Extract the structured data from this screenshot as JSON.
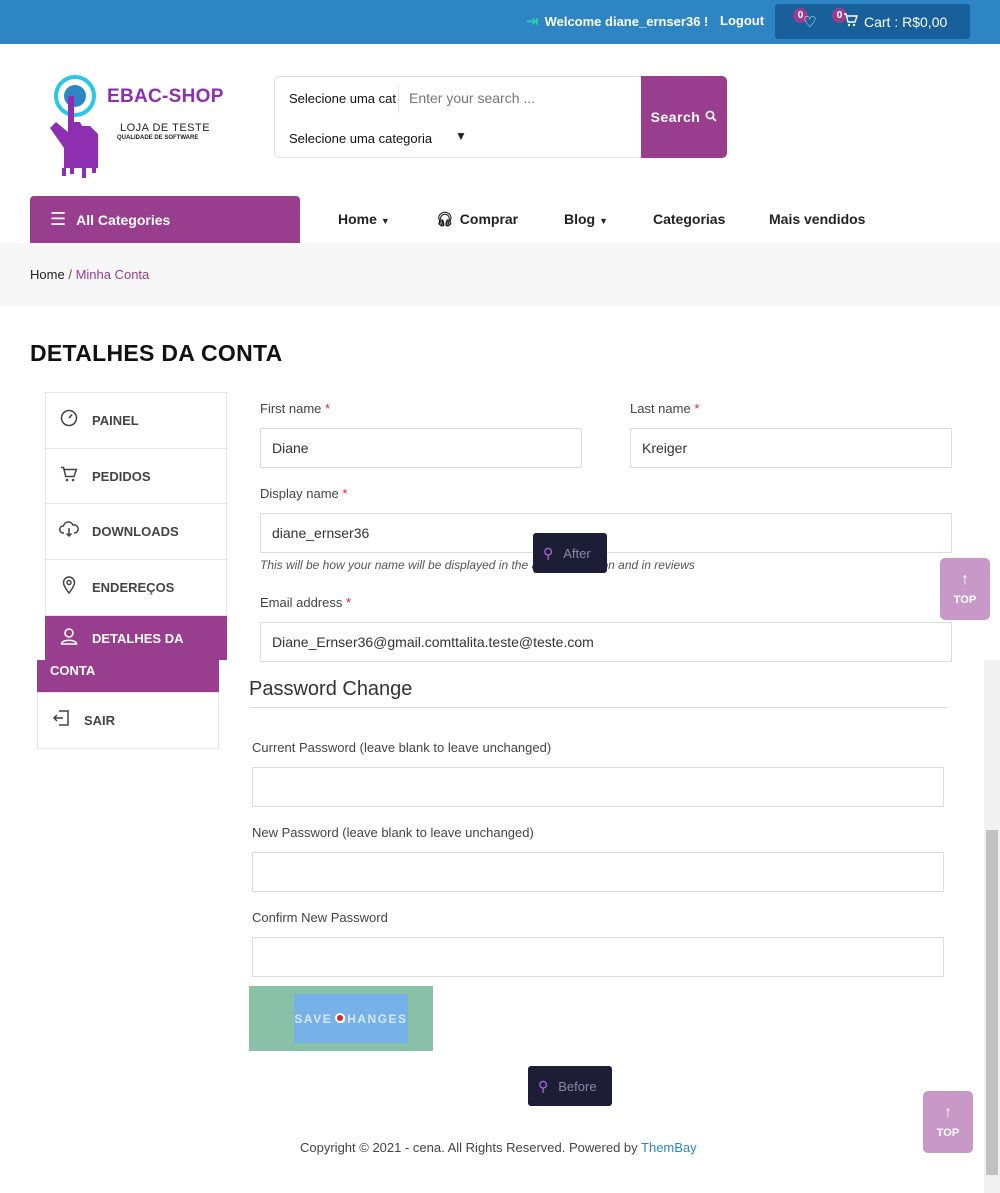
{
  "topbar": {
    "welcome": "Welcome diane_ernser36 !",
    "logout": "Logout",
    "wishlist_count": "0",
    "cart_count": "0",
    "cart_label": "Cart : R$0,00"
  },
  "logo": {
    "title": "EBAC-SHOP",
    "subtitle": "LOJA DE TESTE",
    "tagline": "QUALIDADE DE SOFTWARE"
  },
  "search": {
    "category_short": "Selecione uma cat",
    "placeholder": "Enter your search ...",
    "category_select": "Selecione uma categoria",
    "button": "Search"
  },
  "nav": {
    "all_categories": "All Categories",
    "items": [
      "Home",
      "Comprar",
      "Blog",
      "Categorias",
      "Mais vendidos"
    ]
  },
  "breadcrumb": {
    "home": "Home",
    "separator": "/",
    "current": "Minha Conta"
  },
  "page_title": "DETALHES DA CONTA",
  "account_nav": {
    "items": [
      "PAINEL",
      "PEDIDOS",
      "DOWNLOADS",
      "ENDEREÇOS",
      "DETALHES DA",
      "CONTA",
      "SAIR"
    ]
  },
  "form": {
    "first_name_label": "First name",
    "first_name_value": "Diane",
    "last_name_label": "Last name",
    "last_name_value": "Kreiger",
    "display_name_label": "Display name",
    "display_name_value": "diane_ernser36",
    "display_name_hint": "This will be how your name will be displayed in the account section and in reviews",
    "email_label": "Email address",
    "email_value": "Diane_Ernser36@gmail.comttalita.teste@teste.com",
    "required_mark": "*"
  },
  "password": {
    "title": "Password Change",
    "current_label": "Current Password (leave blank to leave unchanged)",
    "new_label": "New Password (leave blank to leave unchanged)",
    "confirm_label": "Confirm New Password"
  },
  "save_button": "SAVE CHANGES",
  "tooltips": {
    "after": "After",
    "before": "Before"
  },
  "top_button": "TOP",
  "footer": {
    "copyright": "Copyright © 2021 - cena. All Rights Reserved. Powered by",
    "brand": "ThemBay"
  },
  "colors": {
    "topbar": "#2d86c3",
    "accent": "#993d8e",
    "cart_box": "#17609c"
  }
}
